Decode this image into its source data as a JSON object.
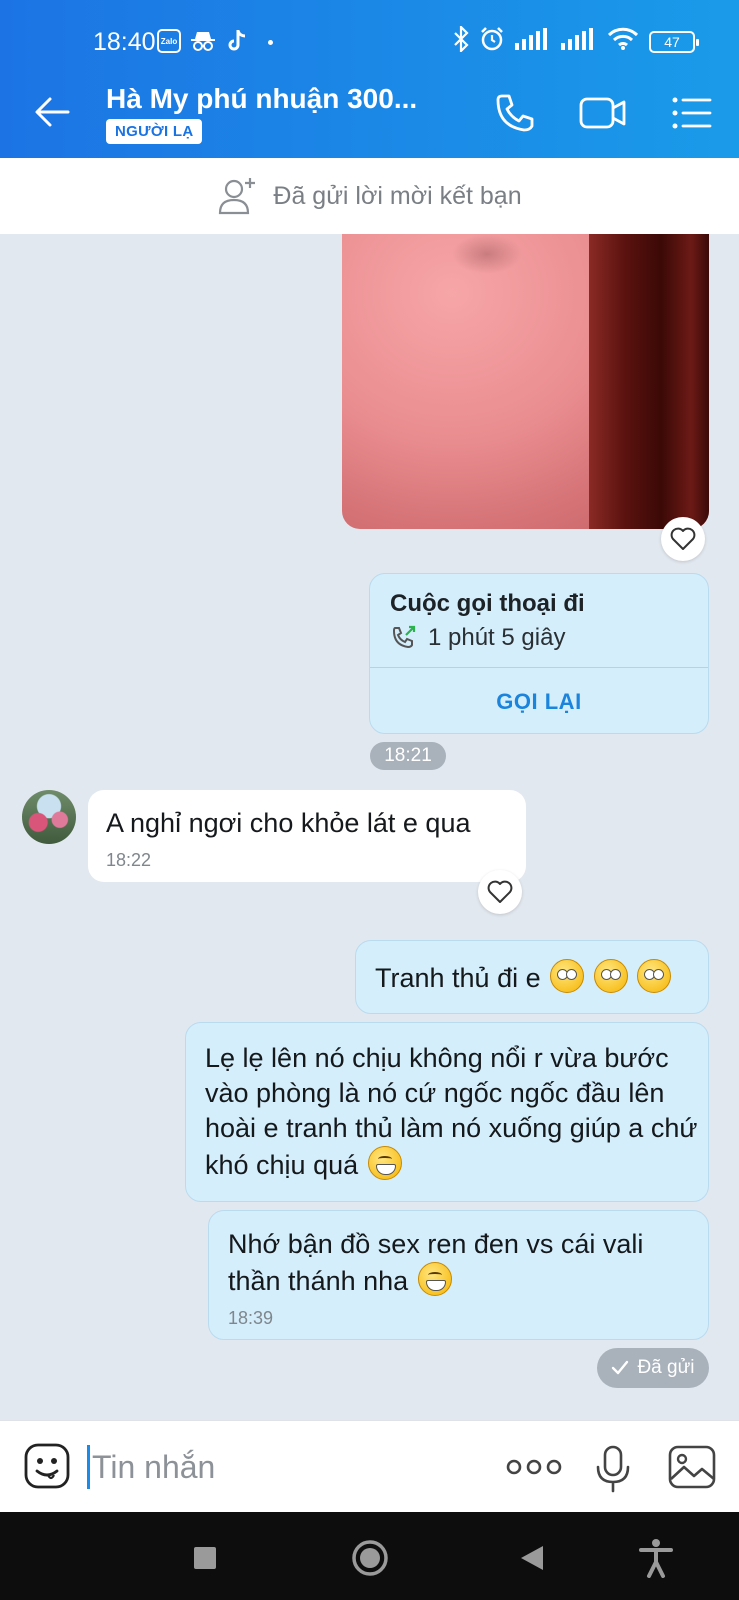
{
  "status_bar": {
    "time": "18:40",
    "app_zalo": "Zalo",
    "battery": "47"
  },
  "header": {
    "title": "Hà My phú nhuận 300...",
    "badge": "NGƯỜI LẠ"
  },
  "friend_request": {
    "text": "Đã gửi lời mời kết bạn"
  },
  "call_card": {
    "title": "Cuộc gọi thoại đi",
    "duration": "1 phút 5 giây",
    "recall_label": "GỌI LẠI"
  },
  "time_divider": "18:21",
  "messages": [
    {
      "from": "contact",
      "text": "A nghỉ ngơi cho khỏe lát e qua",
      "time": "18:22"
    },
    {
      "from": "me",
      "text": "Tranh thủ đi e",
      "emojis": [
        "flushed-face",
        "flushed-face",
        "flushed-face"
      ]
    },
    {
      "from": "me",
      "text": "Lẹ lẹ lên nó chịu không nổi r vừa bước vào phòng là nó cứ ngốc ngốc đầu lên hoài e tranh thủ làm nó xuống giúp a chứ khó chịu quá",
      "emojis": [
        "grinning-face"
      ]
    },
    {
      "from": "me",
      "text": "Nhớ bận đồ sex ren đen vs cái vali thần thánh nha",
      "emojis": [
        "grinning-face"
      ],
      "time": "18:39"
    }
  ],
  "sent_status": "Đã gửi",
  "input": {
    "placeholder": "Tin nhắn"
  },
  "colors": {
    "header_start": "#1c74e4",
    "header_end": "#1a9be9",
    "sent_bubble": "#d4eefc",
    "chat_bg": "#e2e8ef",
    "link": "#1b84dc"
  },
  "icons": [
    "back-arrow-icon",
    "phone-icon",
    "video-camera-icon",
    "menu-icon",
    "add-friend-icon",
    "heart-icon",
    "outgoing-call-icon",
    "check-icon",
    "sticker-icon",
    "more-icon",
    "microphone-icon",
    "image-icon"
  ]
}
